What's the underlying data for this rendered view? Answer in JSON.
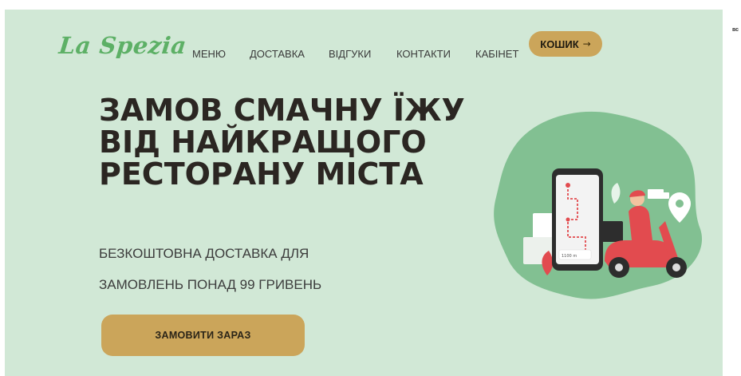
{
  "brand": {
    "logo": "La Spezia"
  },
  "nav": {
    "items": [
      "МЕНЮ",
      "ДОСТАВКА",
      "ВІДГУКИ",
      "КОНТАКТИ",
      "КАБІНЕТ"
    ],
    "cart_label": "КОШИК",
    "cart_arrow": "→"
  },
  "hero": {
    "headline": "ЗАМОВ СМАЧНУ ЇЖУ ВІД НАЙКРАЩОГО РЕСТОРАНУ МІСТА",
    "subline_1": "БЕЗКОШТОВНА ДОСТАВКА ДЛЯ",
    "subline_2": "ЗАМОВЛЕНЬ ПОНАД 99 ГРИВЕНЬ",
    "cta_label": "ЗАМОВИТИ ЗАРАЗ"
  },
  "illustration": {
    "phone_screen_text": "1100 m"
  },
  "side_text": "вс",
  "colors": {
    "background": "#d1e8d6",
    "accent_gold": "#cba55a",
    "brand_green": "#5db066",
    "blob_green": "#82c092",
    "scooter_red": "#e24b4f",
    "headline": "#2b2622"
  }
}
